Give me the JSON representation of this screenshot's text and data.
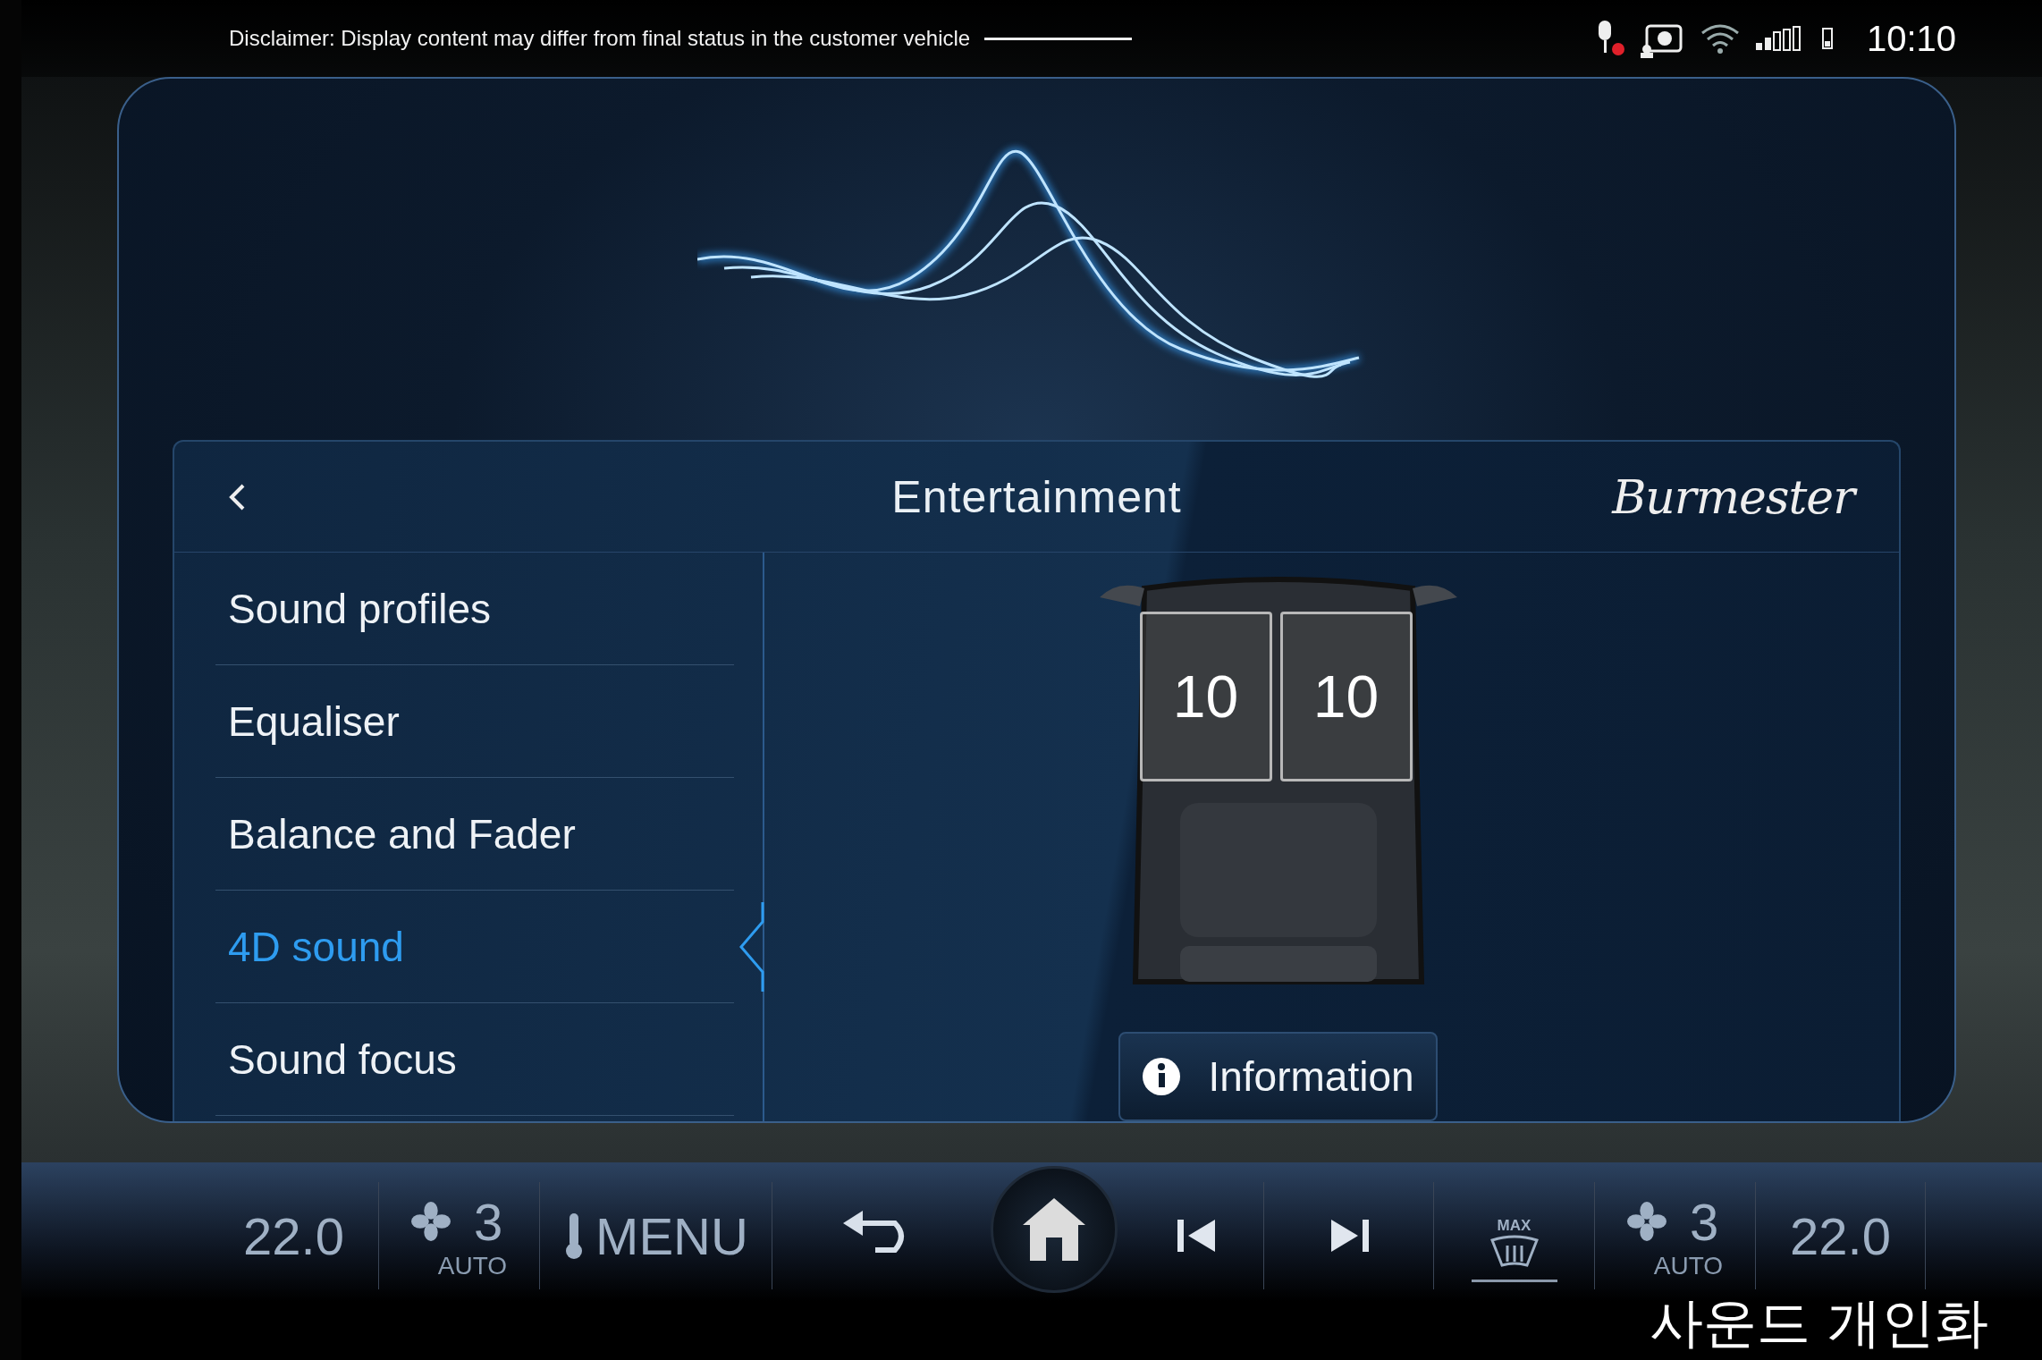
{
  "status_bar": {
    "disclaimer": "Disclaimer: Display content may differ from final status in the customer vehicle",
    "time": "10:10"
  },
  "panel": {
    "title": "Entertainment",
    "brand": "Burmester",
    "menu": [
      {
        "label": "Sound profiles",
        "selected": false
      },
      {
        "label": "Equaliser",
        "selected": false
      },
      {
        "label": "Balance and Fader",
        "selected": false
      },
      {
        "label": "4D sound",
        "selected": true
      },
      {
        "label": "Sound focus",
        "selected": false
      }
    ],
    "seats": [
      {
        "value": "10"
      },
      {
        "value": "10"
      }
    ],
    "info_button": "Information"
  },
  "climate_bar": {
    "left_temp": "22.0",
    "left_fan": {
      "speed": "3",
      "mode": "AUTO"
    },
    "menu": "MENU",
    "defrost": {
      "label": "MAX",
      "active": true
    },
    "right_fan": {
      "speed": "3",
      "mode": "AUTO"
    },
    "right_temp": "22.0"
  },
  "caption": "사운드 개인화"
}
